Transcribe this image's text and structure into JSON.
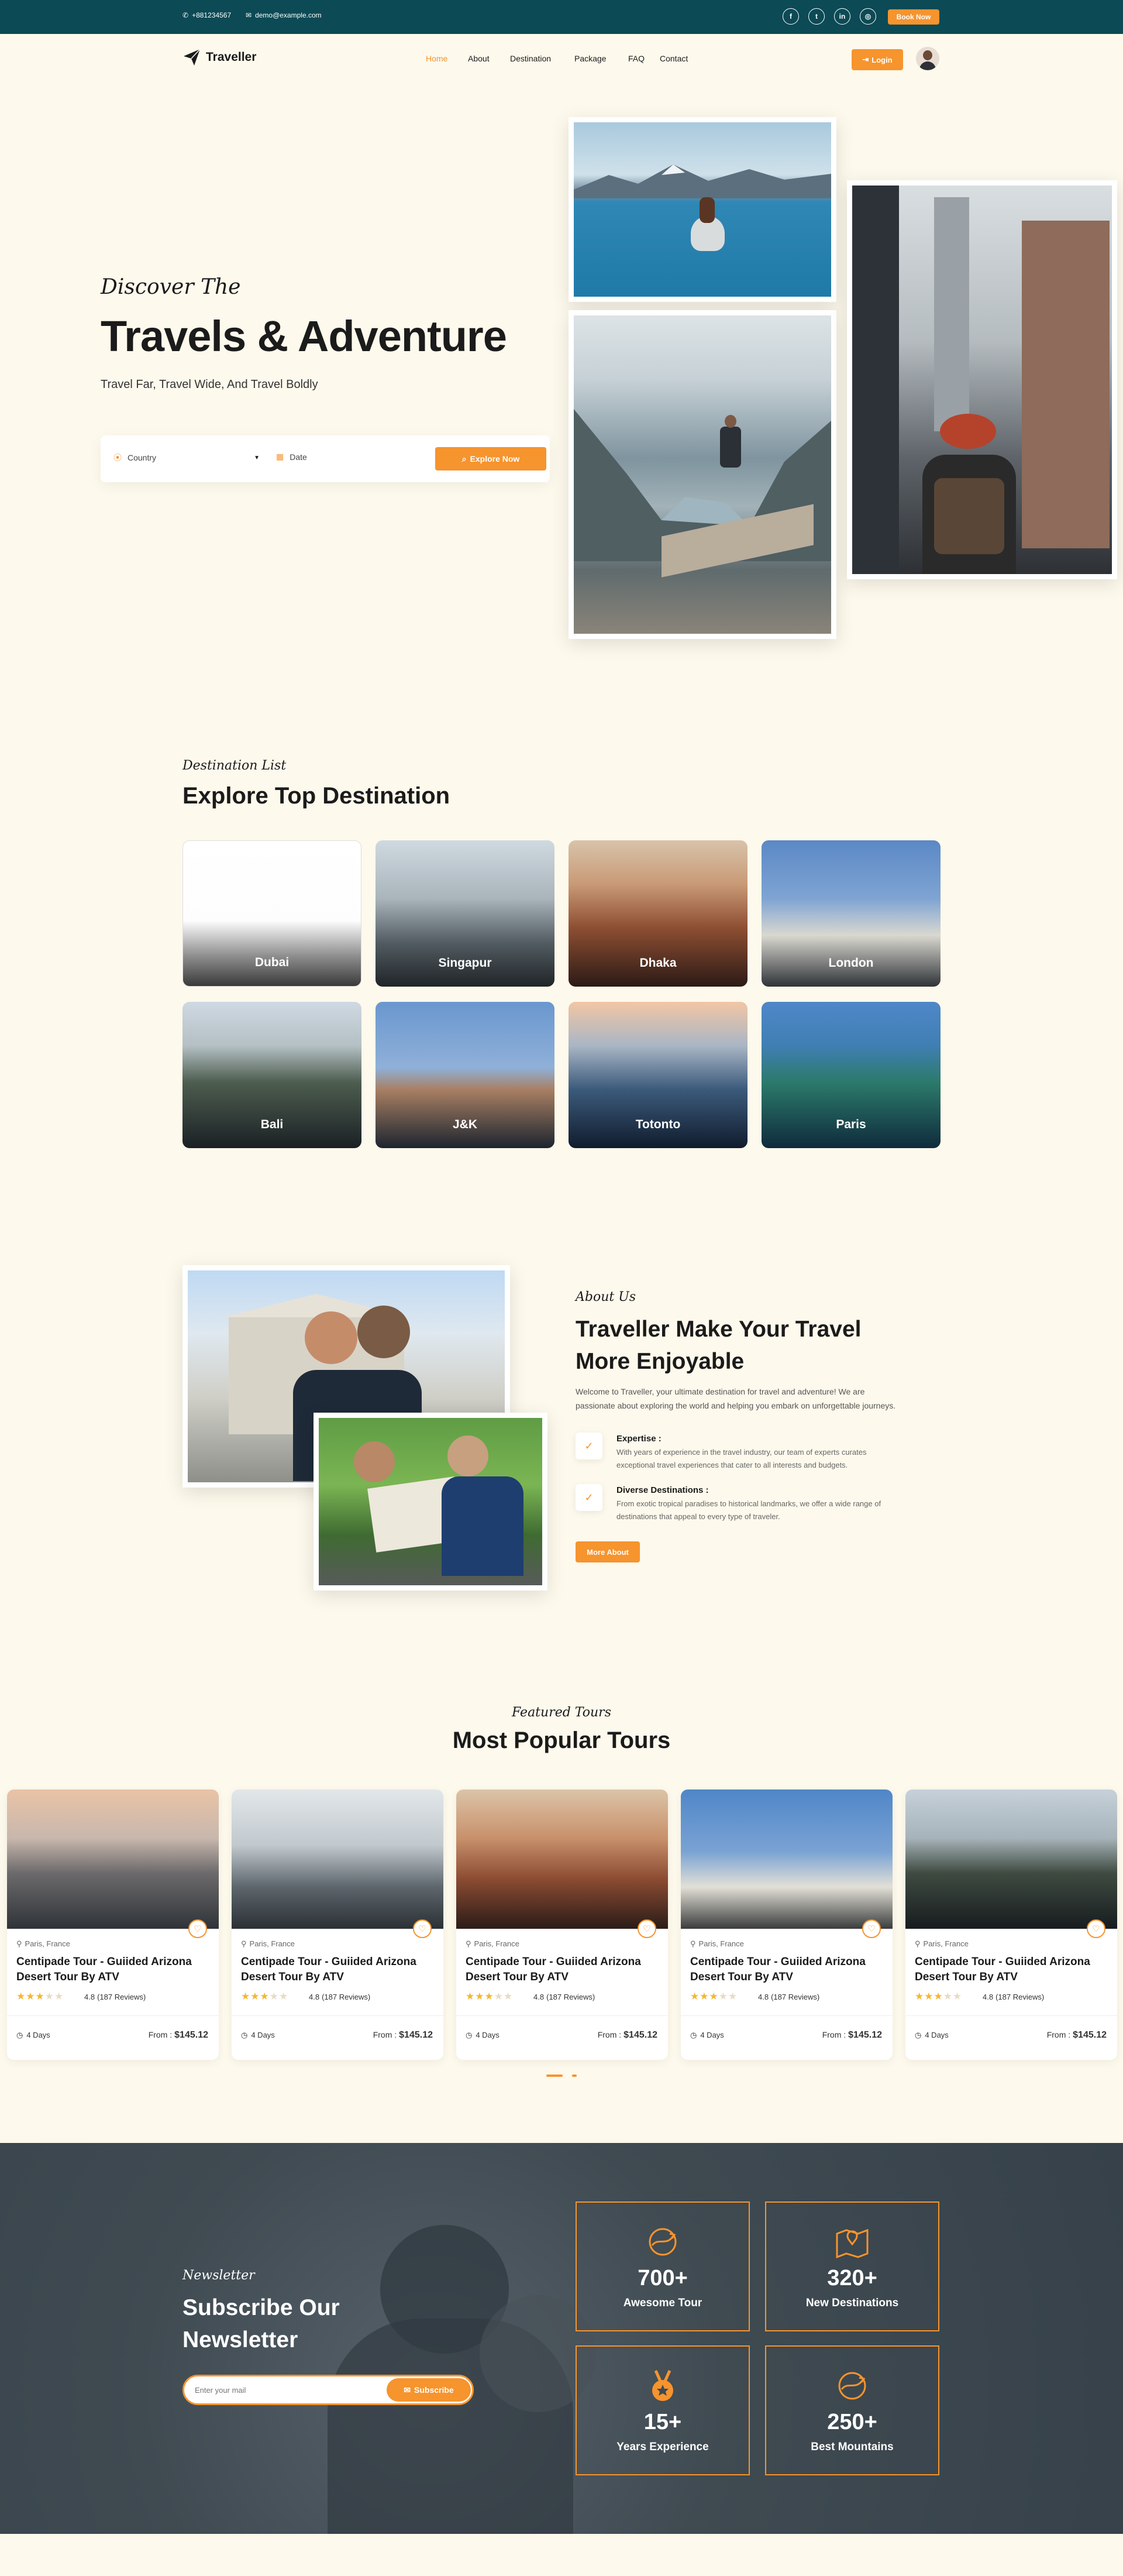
{
  "topbar": {
    "phone": "+881234567",
    "email": "demo@example.com",
    "social_icons": [
      "facebook-icon",
      "twitter-icon",
      "linkedin-icon",
      "instagram-icon"
    ],
    "book_label": "Book Now"
  },
  "nav": {
    "brand": "Traveller",
    "links": [
      "Home",
      "About",
      "Destination",
      "Package",
      "FAQ",
      "Contact"
    ],
    "active": "Home",
    "login_label": "Login"
  },
  "hero": {
    "script": "Discover The",
    "title": "Travels & Adventure",
    "subtitle": "Travel Far, Travel Wide, And Travel Boldly",
    "country_placeholder": "Country",
    "date_placeholder": "Date",
    "explore_label": "Explore Now"
  },
  "destinations": {
    "script": "Destination List",
    "title": "Explore Top Destination",
    "items": [
      "Dubai",
      "Singapur",
      "Dhaka",
      "London",
      "Bali",
      "J&K",
      "Totonto",
      "Paris"
    ]
  },
  "about": {
    "script": "About Us",
    "title_line1": "Traveller Make Your Travel",
    "title_line2": "More Enjoyable",
    "intro_line1": "Welcome to Traveller, your ultimate destination for travel and adventure! We are",
    "intro_line2": "passionate about exploring the world and helping you embark on unforgettable journeys.",
    "features": [
      {
        "title": "Expertise :",
        "line1": "With years of experience in the travel industry, our team of experts curates",
        "line2": "exceptional travel experiences that cater to all interests and budgets."
      },
      {
        "title": "Diverse Destinations :",
        "line1": "From exotic tropical paradises to historical landmarks, we offer a wide range of",
        "line2": "destinations that appeal to every type of traveler."
      }
    ],
    "more_label": "More About"
  },
  "tours": {
    "script": "Featured Tours",
    "title": "Most Popular Tours",
    "items": [
      {
        "location": "Paris, France",
        "name_line1": "Centipade Tour - Guiided Arizona",
        "name_line2": "Desert Tour By ATV",
        "rating": "4.8",
        "reviews": "(187 Reviews)",
        "stars": 3,
        "days": "4 Days",
        "from": "From :",
        "price": "$145.12"
      },
      {
        "location": "Paris, France",
        "name_line1": "Centipade Tour - Guiided Arizona",
        "name_line2": "Desert Tour By ATV",
        "rating": "4.8",
        "reviews": "(187 Reviews)",
        "stars": 3,
        "days": "4 Days",
        "from": "From :",
        "price": "$145.12"
      },
      {
        "location": "Paris, France",
        "name_line1": "Centipade Tour - Guiided Arizona",
        "name_line2": "Desert Tour By ATV",
        "rating": "4.8",
        "reviews": "(187 Reviews)",
        "stars": 3,
        "days": "4 Days",
        "from": "From :",
        "price": "$145.12"
      },
      {
        "location": "Paris, France",
        "name_line1": "Centipade Tour - Guiided Arizona",
        "name_line2": "Desert Tour By ATV",
        "rating": "4.8",
        "reviews": "(187 Reviews)",
        "stars": 3,
        "days": "4 Days",
        "from": "From :",
        "price": "$145.12"
      },
      {
        "location": "Paris, France",
        "name_line1": "Centipade Tour - Guiided Arizona",
        "name_line2": "Desert Tour By ATV",
        "rating": "4.8",
        "reviews": "(187 Reviews)",
        "stars": 3,
        "days": "4 Days",
        "from": "From :",
        "price": "$145.12"
      }
    ]
  },
  "newsletter": {
    "script": "Newsletter",
    "title_line1": "Subscribe Our",
    "title_line2": "Newsletter",
    "email_placeholder": "Enter your mail",
    "subscribe_label": "Subscribe",
    "stats": [
      {
        "value": "700+",
        "label": "Awesome Tour",
        "icon": "globe-plane-icon"
      },
      {
        "value": "320+",
        "label": "New Destinations",
        "icon": "map-pin-icon"
      },
      {
        "value": "15+",
        "label": "Years Experience",
        "icon": "medal-icon"
      },
      {
        "value": "250+",
        "label": "Best Mountains",
        "icon": "globe-plane-icon"
      }
    ]
  },
  "colors": {
    "accent": "#f6942e",
    "topbar": "#0c4a55",
    "background": "#fdf9ec",
    "dark": "#3f4a51"
  }
}
